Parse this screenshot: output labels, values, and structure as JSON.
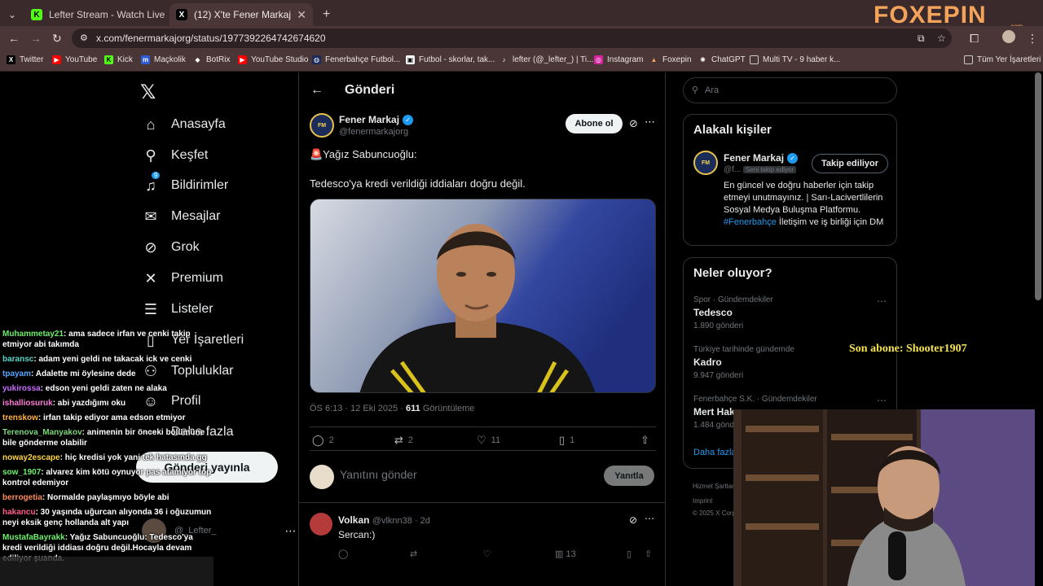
{
  "browser": {
    "tabs": [
      {
        "label": "Lefter Stream - Watch Live on K",
        "icon": "K",
        "active": false
      },
      {
        "label": "(12) X'te Fener Markaj: \"🚨Yağı",
        "icon": "X",
        "active": true
      }
    ],
    "url": "x.com/fenermarkajorg/status/1977392264742674620",
    "bookmarks": [
      "Twitter",
      "YouTube",
      "Kick",
      "Maçkolik",
      "BotRix",
      "YouTube Studio",
      "Fenerbahçe Futbol...",
      "Futbol - skorlar, tak...",
      "lefter (@_lefter_) | Ti...",
      "Instagram",
      "Foxepin",
      "ChatGPT",
      "Multi TV - 9 haber k...",
      "Tüm Yer İşaretleri"
    ]
  },
  "overlay": {
    "brand": "FOXEPIN",
    "brand_sub": ".com",
    "last_sub": "Son abone: Shooter1907"
  },
  "nav": {
    "items": [
      {
        "label": "Anasayfa",
        "icon": "home-icon"
      },
      {
        "label": "Keşfet",
        "icon": "search-icon"
      },
      {
        "label": "Bildirimler",
        "icon": "bell-icon",
        "badge": "9"
      },
      {
        "label": "Mesajlar",
        "icon": "mail-icon"
      },
      {
        "label": "Grok",
        "icon": "grok-icon"
      },
      {
        "label": "Premium",
        "icon": "x-icon"
      },
      {
        "label": "Listeler",
        "icon": "list-icon"
      },
      {
        "label": "Yer İşaretleri",
        "icon": "bookmark-icon"
      },
      {
        "label": "Topluluklar",
        "icon": "people-icon"
      },
      {
        "label": "Profil",
        "icon": "person-icon"
      },
      {
        "label": "Daha fazla",
        "icon": "more-icon"
      }
    ],
    "post_button": "Gönderi yayınla",
    "account_handle": "@_Lefter_"
  },
  "post": {
    "header": "Gönderi",
    "author_name": "Fener Markaj",
    "author_handle": "@fenermarkajorg",
    "subscribe": "Abone ol",
    "line1": "🚨Yağız Sabuncuoğlu:",
    "line2": "Tedesco'ya kredi verildiği iddiaları doğru değil.",
    "time": "ÖS 6:13 · 12 Eki 2025 · ",
    "views": "611",
    "views_label": " Görüntüleme",
    "replies": "2",
    "reposts": "2",
    "likes": "11",
    "bookmarks": "1",
    "reply_placeholder": "Yanıtını gönder",
    "reply_button": "Yanıtla"
  },
  "comment": {
    "name": "Volkan",
    "handle": "@vlknn38 · 2d",
    "text": "Sercan:)",
    "views": "13"
  },
  "sidebar": {
    "search_placeholder": "Ara",
    "related_title": "Alakalı kişiler",
    "related_name": "Fener Markaj",
    "related_handle": "@f...",
    "follows_you": "Seni takip ediyor",
    "following_btn": "Takip ediliyor",
    "bio": "En güncel ve doğru haberler için takip etmeyi unutmayınız. | Sarı-Lacivertlilerin Sosyal Medya Buluşma Platformu. ",
    "bio_tag": "#Fenerbahçe",
    "bio_end": " İletişim ve iş birliği için DM",
    "trends_title": "Neler oluyor?",
    "trends": [
      {
        "cat": "Spor · Gündemdekiler",
        "name": "Tedesco",
        "count": "1.890 gönderi"
      },
      {
        "cat": "Türkiye tarihinde gündemde",
        "name": "Kadro",
        "count": "9.947 gönderi"
      },
      {
        "cat": "Fenerbahçe S.K. · Gündemdekiler",
        "name": "Mert Hakan",
        "count": "1.484 gönderi"
      }
    ],
    "show_more": "Daha fazla",
    "footer1": "Hizmet Şartları",
    "footer2": "Imprint",
    "footer3": "© 2025 X Corp."
  },
  "chat": [
    {
      "user": "Muhammetay21",
      "color": "#6cf06c",
      "msg": ": ama sadece irfan ve cenki takip etmiyor abi takımda"
    },
    {
      "user": "baransc",
      "color": "#58d6c8",
      "msg": ": adam yeni geldi ne takacak ick ve cenki"
    },
    {
      "user": "tpayam",
      "color": "#59a6ff",
      "msg": ": Adalette mi öylesine dede"
    },
    {
      "user": "yukirossa",
      "color": "#c86cff",
      "msg": ": edson yeni geldi zaten ne alaka"
    },
    {
      "user": "ishalliosuruk",
      "color": "#ff7ad9",
      "msg": ": abi yazdığımı oku"
    },
    {
      "user": "trenskow",
      "color": "#ffb347",
      "msg": ": irfan takip ediyor ama edson etmiyor"
    },
    {
      "user": "Terenova_Manyakov",
      "color": "#7cd67c",
      "msg": ": animenin bir önceki bölümüne bile gönderme olabilir"
    },
    {
      "user": "noway2escape",
      "color": "#ffd447",
      "msg": ": hiç kredisi yok yani tek hatasında gg"
    },
    {
      "user": "sow_1907",
      "color": "#6cf06c",
      "msg": ": alvarez kim kötü oynuyor pas atamıyor top kontrol edemiyor"
    },
    {
      "user": "berrogetia",
      "color": "#ff8a5c",
      "msg": ": Normalde paylaşmıyo böyle abi"
    },
    {
      "user": "hakancu",
      "color": "#ff5c8a",
      "msg": ": 30 yaşında uğurcan alıyonda 36 i oğuzumun neyi eksik genç hollanda alt yapı"
    },
    {
      "user": "MustafaBayrakk",
      "color": "#6cf06c",
      "msg": ": Yağız Sabuncuoğlu: Tedesco'ya kredi verildiği iddiası doğru değil.Hocayla devam ediliyor şuanda."
    }
  ]
}
